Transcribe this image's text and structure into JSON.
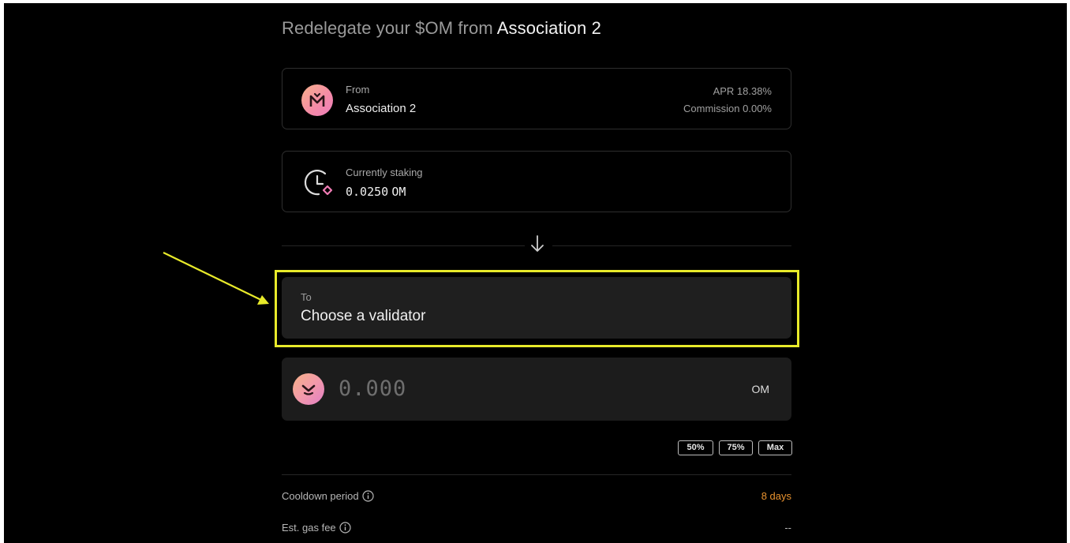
{
  "heading": {
    "prefix": "Redelegate your $OM from",
    "validator": "Association 2"
  },
  "from_card": {
    "label": "From",
    "validator_name": "Association 2",
    "apr": "APR 18.38%",
    "commission": "Commission 0.00%",
    "avatar_icon": "mantra-m-logo"
  },
  "staking_card": {
    "label": "Currently staking",
    "amount": "0.0250",
    "unit": "OM",
    "icon": "clock-token-icon"
  },
  "arrow_icon": "arrow-down-icon",
  "to_field": {
    "label": "To",
    "placeholder": "Choose a validator"
  },
  "amount": {
    "placeholder": "0.000",
    "unit": "OM",
    "icon": "om-token-icon"
  },
  "percent_buttons": [
    "50%",
    "75%",
    "Max"
  ],
  "info": {
    "cooldown": {
      "label": "Cooldown period",
      "value": "8 days",
      "value_color": "#e8922f"
    },
    "gas_fee": {
      "label": "Est. gas fee",
      "value": "--"
    }
  },
  "colors": {
    "highlight": "#e8ea2a",
    "background": "#000000",
    "field_bg": "#1f1f1f"
  }
}
